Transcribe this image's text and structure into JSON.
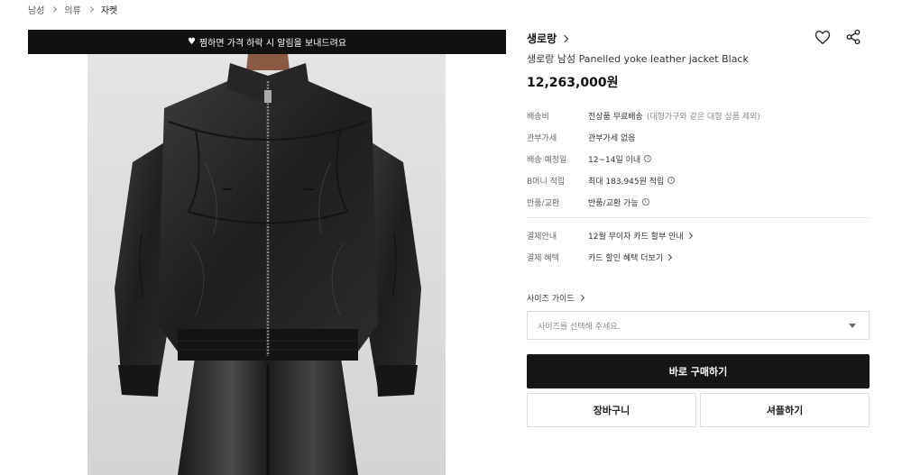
{
  "breadcrumb": {
    "items": [
      "남성",
      "의류",
      "자켓"
    ]
  },
  "banner": {
    "text": "찜하면 가격 하락 시 알림을 보내드려요"
  },
  "product": {
    "brand": "생로랑",
    "name": "생로랑 남성 Panelled yoke leather jacket Black",
    "price": "12,263,000원"
  },
  "details": [
    {
      "label": "배송비",
      "value": "전상품 무료배송",
      "note": "(대형가구와 같은 대형 상품 제외)"
    },
    {
      "label": "관부가세",
      "value": "관부가세 없음"
    },
    {
      "label": "배송 예정일",
      "value": "12~14일 이내"
    },
    {
      "label": "B머니 적립",
      "value": "최대 183,945원 적립"
    },
    {
      "label": "반품/교환",
      "value": "반품/교환 가능"
    }
  ],
  "payment": [
    {
      "label": "결제안내",
      "value": "12월 무이자 카드 할부 안내"
    },
    {
      "label": "결제 혜택",
      "value": "카드 할인 혜택 더보기"
    }
  ],
  "size": {
    "guide_label": "사이즈 가이드",
    "placeholder": "사이즈를 선택해 주세요."
  },
  "buttons": {
    "buy": "바로 구매하기",
    "cart": "장바구니",
    "shuffle": "셔플하기"
  },
  "colors": {
    "primary_button": "#161616",
    "banner": "#111111"
  }
}
